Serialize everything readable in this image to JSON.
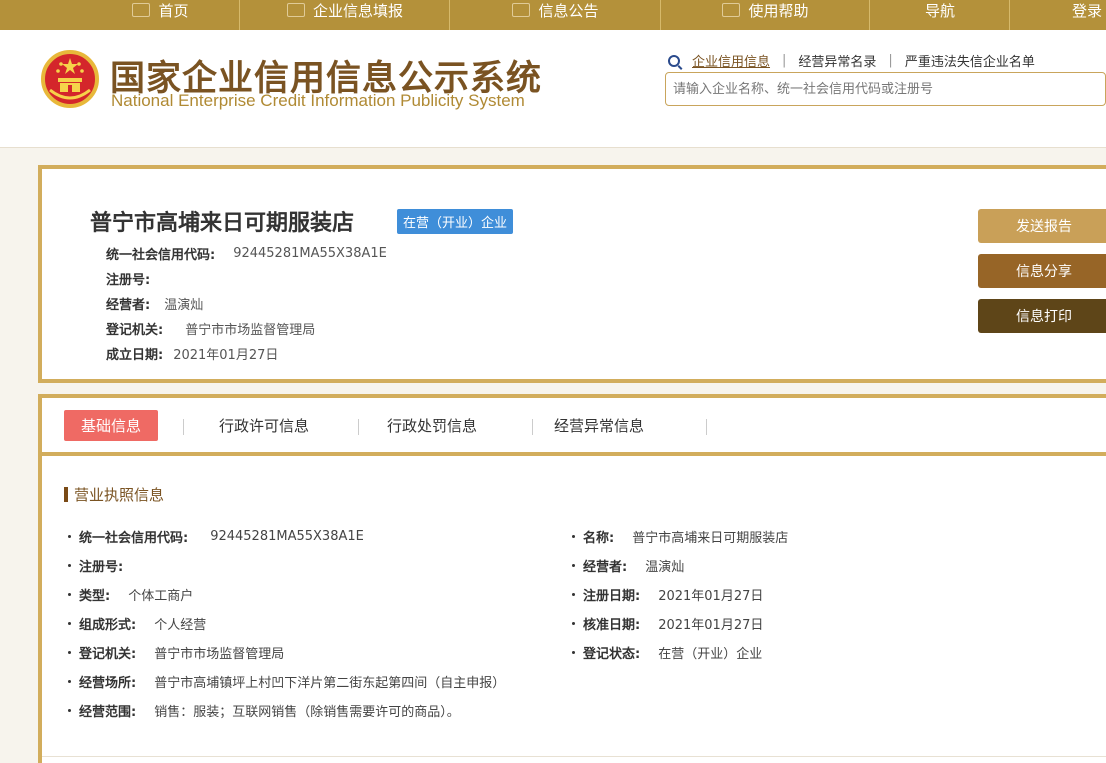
{
  "topnav": {
    "items": [
      {
        "label": "首页",
        "icon": "home-icon"
      },
      {
        "label": "企业信息填报",
        "icon": "pen-icon"
      },
      {
        "label": "信息公告",
        "icon": "document-icon"
      },
      {
        "label": "使用帮助",
        "icon": "speaker-icon"
      },
      {
        "label": "导航",
        "icon": ""
      },
      {
        "label": "登录",
        "icon": ""
      }
    ]
  },
  "header": {
    "title_cn": "国家企业信用信息公示系统",
    "title_en": "National Enterprise Credit Information Publicity System",
    "quick_links": [
      "企业信用信息",
      "经营异常名录",
      "严重违法失信企业名单"
    ],
    "search_placeholder": "请输入企业名称、统一社会信用代码或注册号"
  },
  "company": {
    "name": "普宁市高埔来日可期服装店",
    "status": "在营（开业）企业",
    "info": [
      {
        "label": "统一社会信用代码:",
        "value": "92445281MA55X38A1E"
      },
      {
        "label": "注册号:",
        "value": ""
      },
      {
        "label": "经营者:",
        "value": "温演灿"
      },
      {
        "label": "登记机关:",
        "value": "普宁市市场监督管理局"
      },
      {
        "label": "成立日期:",
        "value": "2021年01月27日"
      }
    ],
    "buttons": {
      "send": "发送报告",
      "share": "信息分享",
      "print": "信息打印"
    }
  },
  "tabs": [
    "基础信息",
    "行政许可信息",
    "行政处罚信息",
    "经营异常信息"
  ],
  "license": {
    "section_title": "营业执照信息",
    "left": [
      {
        "label": "统一社会信用代码:",
        "value": "92445281MA55X38A1E"
      },
      {
        "label": "注册号:",
        "value": ""
      },
      {
        "label": "类型:",
        "value": "个体工商户"
      },
      {
        "label": "组成形式:",
        "value": "个人经营"
      },
      {
        "label": "登记机关:",
        "value": "普宁市市场监督管理局"
      },
      {
        "label": "经营场所:",
        "value": "普宁市高埔镇坪上村凹下洋片第二街东起第四间（自主申报）"
      },
      {
        "label": "经营范围:",
        "value": "销售：服装；互联网销售（除销售需要许可的商品）。"
      }
    ],
    "right": [
      {
        "label": "名称:",
        "value": "普宁市高埔来日可期服装店"
      },
      {
        "label": "经营者:",
        "value": "温演灿"
      },
      {
        "label": "注册日期:",
        "value": "2021年01月27日"
      },
      {
        "label": "核准日期:",
        "value": "2021年01月27日"
      },
      {
        "label": "登记状态:",
        "value": "在营（开业）企业"
      }
    ]
  },
  "colors": {
    "gold": "#b4913a",
    "brown": "#7a5322",
    "status_blue": "#3f8ed9",
    "active_tab": "#ef6a64"
  }
}
